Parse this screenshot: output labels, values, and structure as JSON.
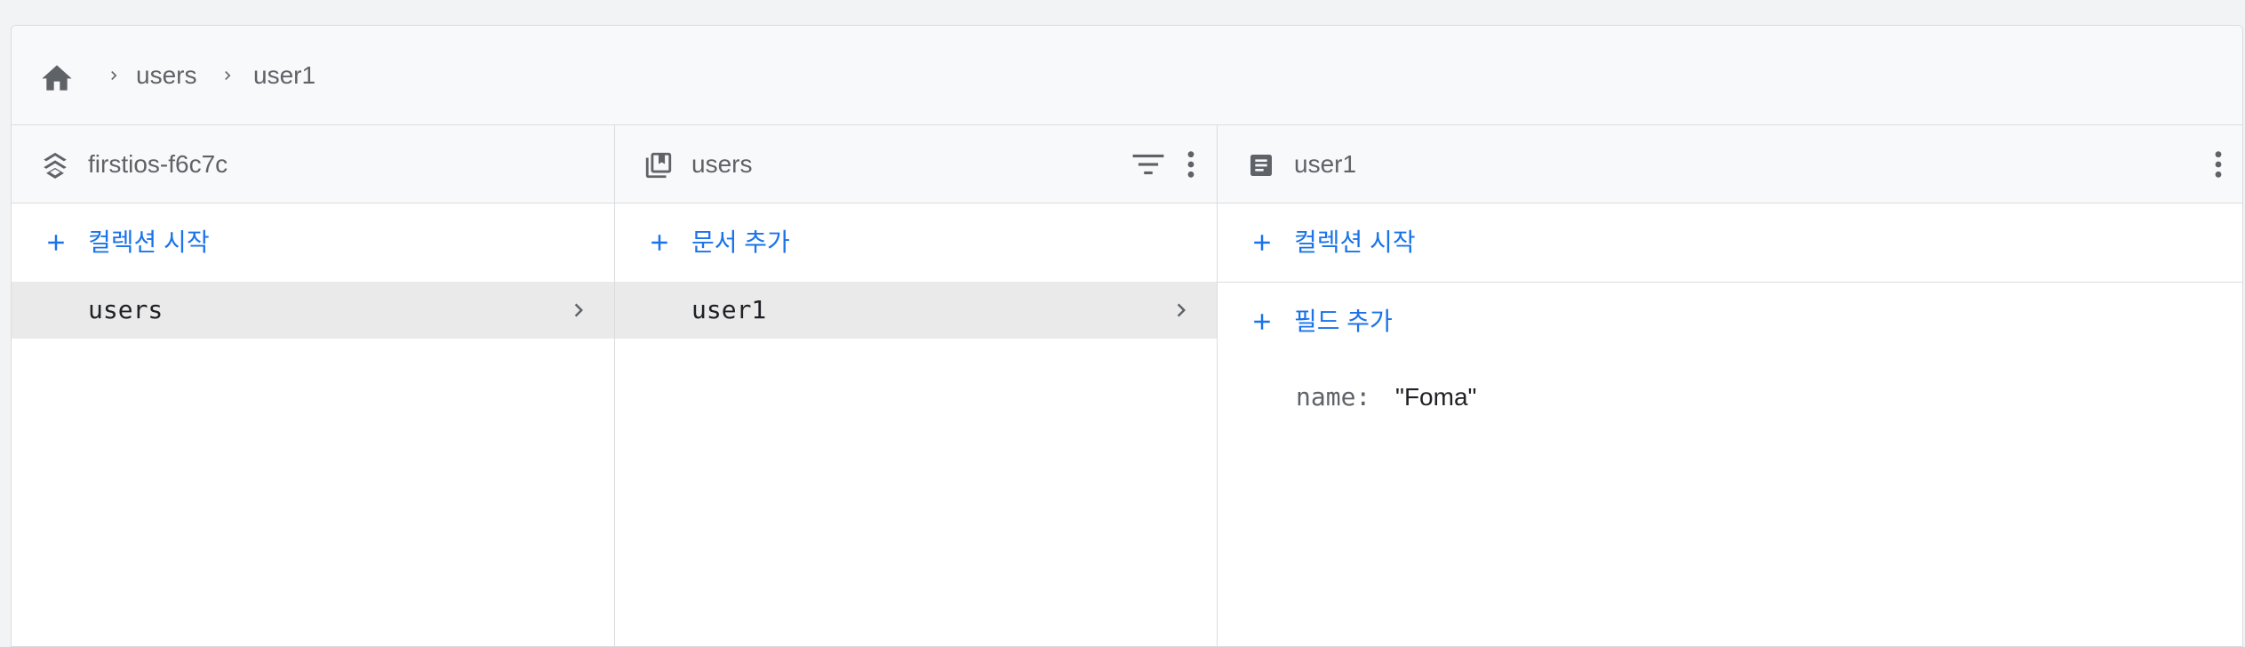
{
  "breadcrumb": {
    "home_icon": "home-icon",
    "items": [
      "users",
      "user1"
    ]
  },
  "columns": {
    "project": {
      "title": "firstios-f6c7c",
      "icon": "firestore-icon",
      "action_label": "컬렉션 시작",
      "items": [
        "users"
      ]
    },
    "collection": {
      "title": "users",
      "icon": "collection-icon",
      "action_label": "문서 추가",
      "items": [
        "user1"
      ],
      "buttons": [
        "filter-icon",
        "more-vert-icon"
      ]
    },
    "document": {
      "title": "user1",
      "icon": "document-icon",
      "collection_action_label": "컬렉션 시작",
      "field_action_label": "필드 추가",
      "fields": [
        {
          "key": "name:",
          "value": "\"Foma\""
        }
      ],
      "buttons": [
        "more-vert-icon"
      ]
    }
  },
  "colors": {
    "accent": "#1a73e8",
    "text_secondary": "#5f6368",
    "text_primary": "#202124",
    "selected_row": "#eaeaea",
    "border": "#dadce0"
  }
}
